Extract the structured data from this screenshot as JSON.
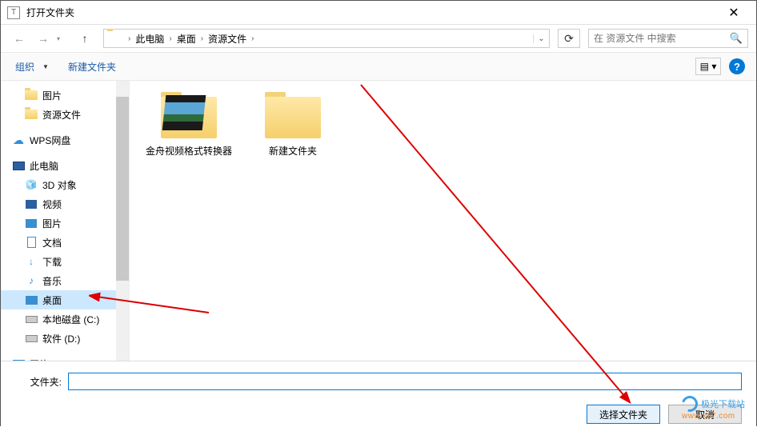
{
  "window": {
    "title": "打开文件夹"
  },
  "nav": {
    "path_parts": [
      "此电脑",
      "桌面",
      "资源文件"
    ],
    "search_placeholder": "在 资源文件 中搜索"
  },
  "toolbar": {
    "organize": "组织",
    "new_folder": "新建文件夹"
  },
  "tree": {
    "items": [
      {
        "label": "图片",
        "icon": "folder",
        "level": 1
      },
      {
        "label": "资源文件",
        "icon": "folder",
        "level": 1
      },
      {
        "label": "WPS网盘",
        "icon": "cloud",
        "level": 0,
        "gapBefore": true
      },
      {
        "label": "此电脑",
        "icon": "pc",
        "level": 0,
        "gapBefore": true
      },
      {
        "label": "3D 对象",
        "icon": "cube",
        "level": 1
      },
      {
        "label": "视频",
        "icon": "video",
        "level": 1
      },
      {
        "label": "图片",
        "icon": "picture",
        "level": 1
      },
      {
        "label": "文档",
        "icon": "doc",
        "level": 1
      },
      {
        "label": "下载",
        "icon": "download",
        "level": 1
      },
      {
        "label": "音乐",
        "icon": "music",
        "level": 1
      },
      {
        "label": "桌面",
        "icon": "desktop",
        "level": 1,
        "selected": true
      },
      {
        "label": "本地磁盘 (C:)",
        "icon": "drive",
        "level": 1
      },
      {
        "label": "软件 (D:)",
        "icon": "drive",
        "level": 1
      },
      {
        "label": "网络",
        "icon": "network",
        "level": 0,
        "gapBefore": true
      }
    ]
  },
  "content": {
    "items": [
      {
        "label": "金舟视频格式转换器",
        "hasPreview": true
      },
      {
        "label": "新建文件夹",
        "hasPreview": false
      }
    ]
  },
  "bottom": {
    "folder_label": "文件夹:",
    "folder_value": "",
    "select_btn": "选择文件夹",
    "cancel_btn": "取消"
  },
  "watermark": {
    "name": "极光下载站",
    "url": "www.xz7.com"
  }
}
